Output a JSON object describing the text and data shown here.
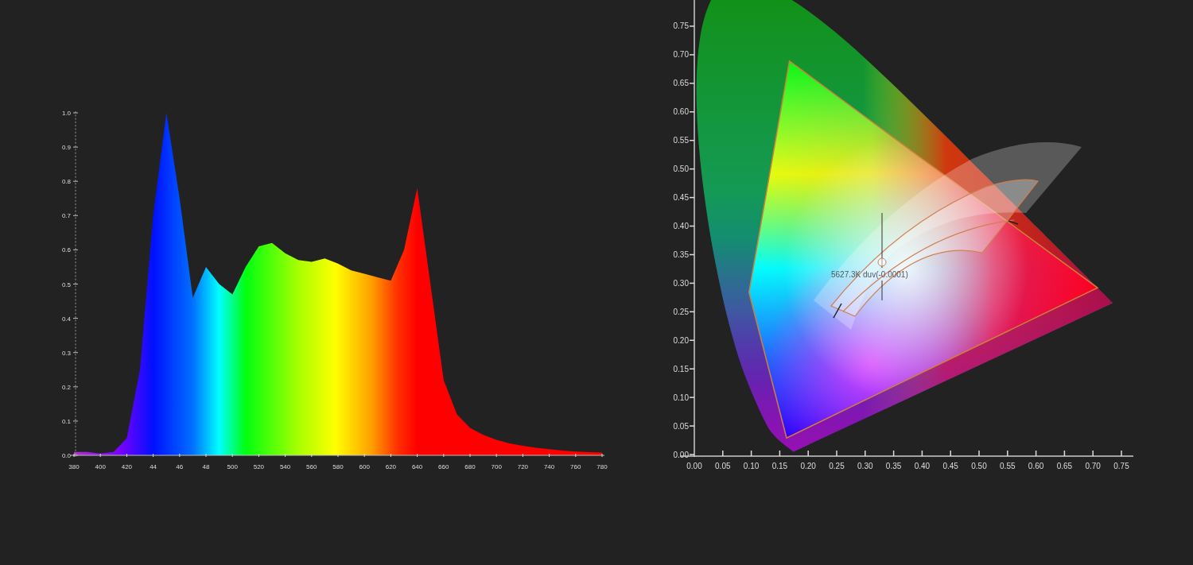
{
  "spectrum": {
    "chart_data": {
      "type": "area",
      "x": [
        380,
        390,
        400,
        410,
        420,
        430,
        440,
        450,
        460,
        470,
        480,
        490,
        500,
        510,
        520,
        530,
        540,
        550,
        560,
        570,
        580,
        590,
        600,
        610,
        620,
        630,
        640,
        650,
        660,
        670,
        680,
        690,
        700,
        710,
        720,
        730,
        740,
        750,
        760,
        770,
        780
      ],
      "values": [
        0.01,
        0.01,
        0.005,
        0.01,
        0.05,
        0.25,
        0.7,
        1.0,
        0.75,
        0.46,
        0.55,
        0.5,
        0.47,
        0.55,
        0.61,
        0.62,
        0.59,
        0.57,
        0.565,
        0.575,
        0.56,
        0.54,
        0.53,
        0.52,
        0.51,
        0.6,
        0.78,
        0.5,
        0.22,
        0.12,
        0.08,
        0.06,
        0.045,
        0.035,
        0.028,
        0.022,
        0.018,
        0.014,
        0.011,
        0.009,
        0.008
      ],
      "xlim": [
        380,
        780
      ],
      "ylim": [
        0,
        1
      ],
      "yticks": [
        {
          "value": 0,
          "label": "0.0"
        },
        {
          "value": 0.1,
          "label": "0.1"
        },
        {
          "value": 0.2,
          "label": "0.2"
        },
        {
          "value": 0.3,
          "label": "0.3"
        },
        {
          "value": 0.4,
          "label": "0.4"
        },
        {
          "value": 0.5,
          "label": "0.5"
        },
        {
          "value": 0.6,
          "label": "0.6"
        },
        {
          "value": 0.7,
          "label": "0.7"
        },
        {
          "value": 0.8,
          "label": "0.8"
        },
        {
          "value": 0.9,
          "label": "0.9"
        },
        {
          "value": 1,
          "label": "1.0"
        }
      ],
      "xticks": [
        {
          "value": 380,
          "label": "380"
        },
        {
          "value": 400,
          "label": "400"
        },
        {
          "value": 420,
          "label": "420"
        },
        {
          "value": 500,
          "label": "500"
        },
        {
          "value": 520,
          "label": "520"
        },
        {
          "value": 540,
          "label": "540"
        },
        {
          "value": 560,
          "label": "560"
        },
        {
          "value": 580,
          "label": "580"
        },
        {
          "value": 600,
          "label": "600"
        },
        {
          "value": 620,
          "label": "620"
        },
        {
          "value": 640,
          "label": "640"
        },
        {
          "value": 660,
          "label": "660"
        },
        {
          "value": 680,
          "label": "680"
        },
        {
          "value": 700,
          "label": "700"
        },
        {
          "value": 720,
          "label": "720"
        },
        {
          "value": 740,
          "label": "740"
        },
        {
          "value": 760,
          "label": "760"
        },
        {
          "value": 780,
          "label": "780"
        }
      ]
    },
    "short_tick_labels": [
      "44",
      "46",
      "48"
    ]
  },
  "chromaticity": {
    "x_ticks": [
      "0.00",
      "0.05",
      "0.10",
      "0.15",
      "0.20",
      "0.25",
      "0.30",
      "0.35",
      "0.40",
      "0.45",
      "0.50",
      "0.55",
      "0.60",
      "0.65",
      "0.70",
      "0.75"
    ],
    "y_ticks": [
      "0.75",
      "0.70",
      "0.65",
      "0.60",
      "0.55",
      "0.50",
      "0.45",
      "0.40",
      "0.35",
      "0.30",
      "0.25",
      "0.20",
      "0.15",
      "0.10",
      "0.05",
      "0.00"
    ],
    "marker_label": "5627.3K duv(-0.0001)"
  }
}
